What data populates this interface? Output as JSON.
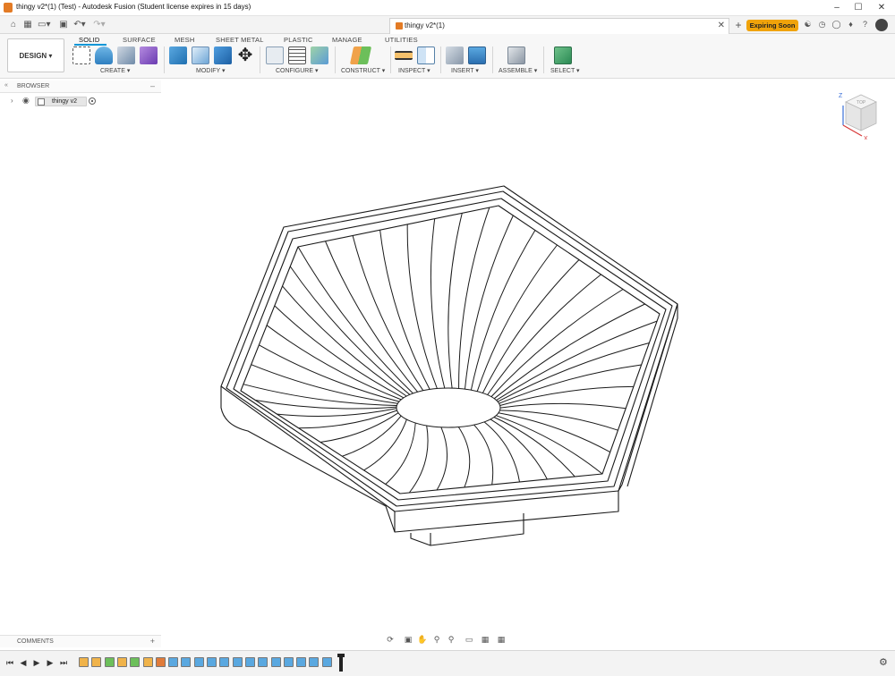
{
  "window": {
    "title": "thingy v2*(1) (Test) - Autodesk Fusion (Student license expires in 15 days)"
  },
  "document_tab": {
    "label": "thingy v2*(1)"
  },
  "header": {
    "expiring_label": "Expiring Soon"
  },
  "ribbon": {
    "workspace_label": "DESIGN",
    "tabs": [
      "SOLID",
      "SURFACE",
      "MESH",
      "SHEET METAL",
      "PLASTIC",
      "MANAGE",
      "UTILITIES"
    ],
    "groups": [
      "CREATE",
      "MODIFY",
      "CONFIGURE",
      "CONSTRUCT",
      "INSPECT",
      "INSERT",
      "ASSEMBLE",
      "SELECT"
    ]
  },
  "browser": {
    "header_label": "BROWSER",
    "root_item_label": "thingy v2"
  },
  "comments": {
    "label": "COMMENTS"
  },
  "viewcube": {
    "face_label": "TOP",
    "axis_z": "Z",
    "axis_x": "X"
  },
  "icons": {
    "home": "home-icon",
    "grid": "grid-icon",
    "file": "file-icon",
    "save": "save-icon",
    "undo": "undo-icon",
    "redo": "redo-icon",
    "orbit": "orbit-icon",
    "pan": "pan-icon",
    "zoom": "zoom-icon",
    "settings": "gear-icon"
  },
  "colors": {
    "accent": "#0696d7",
    "expiring_badge": "#f0a30a",
    "app_orange": "#e37b25"
  }
}
